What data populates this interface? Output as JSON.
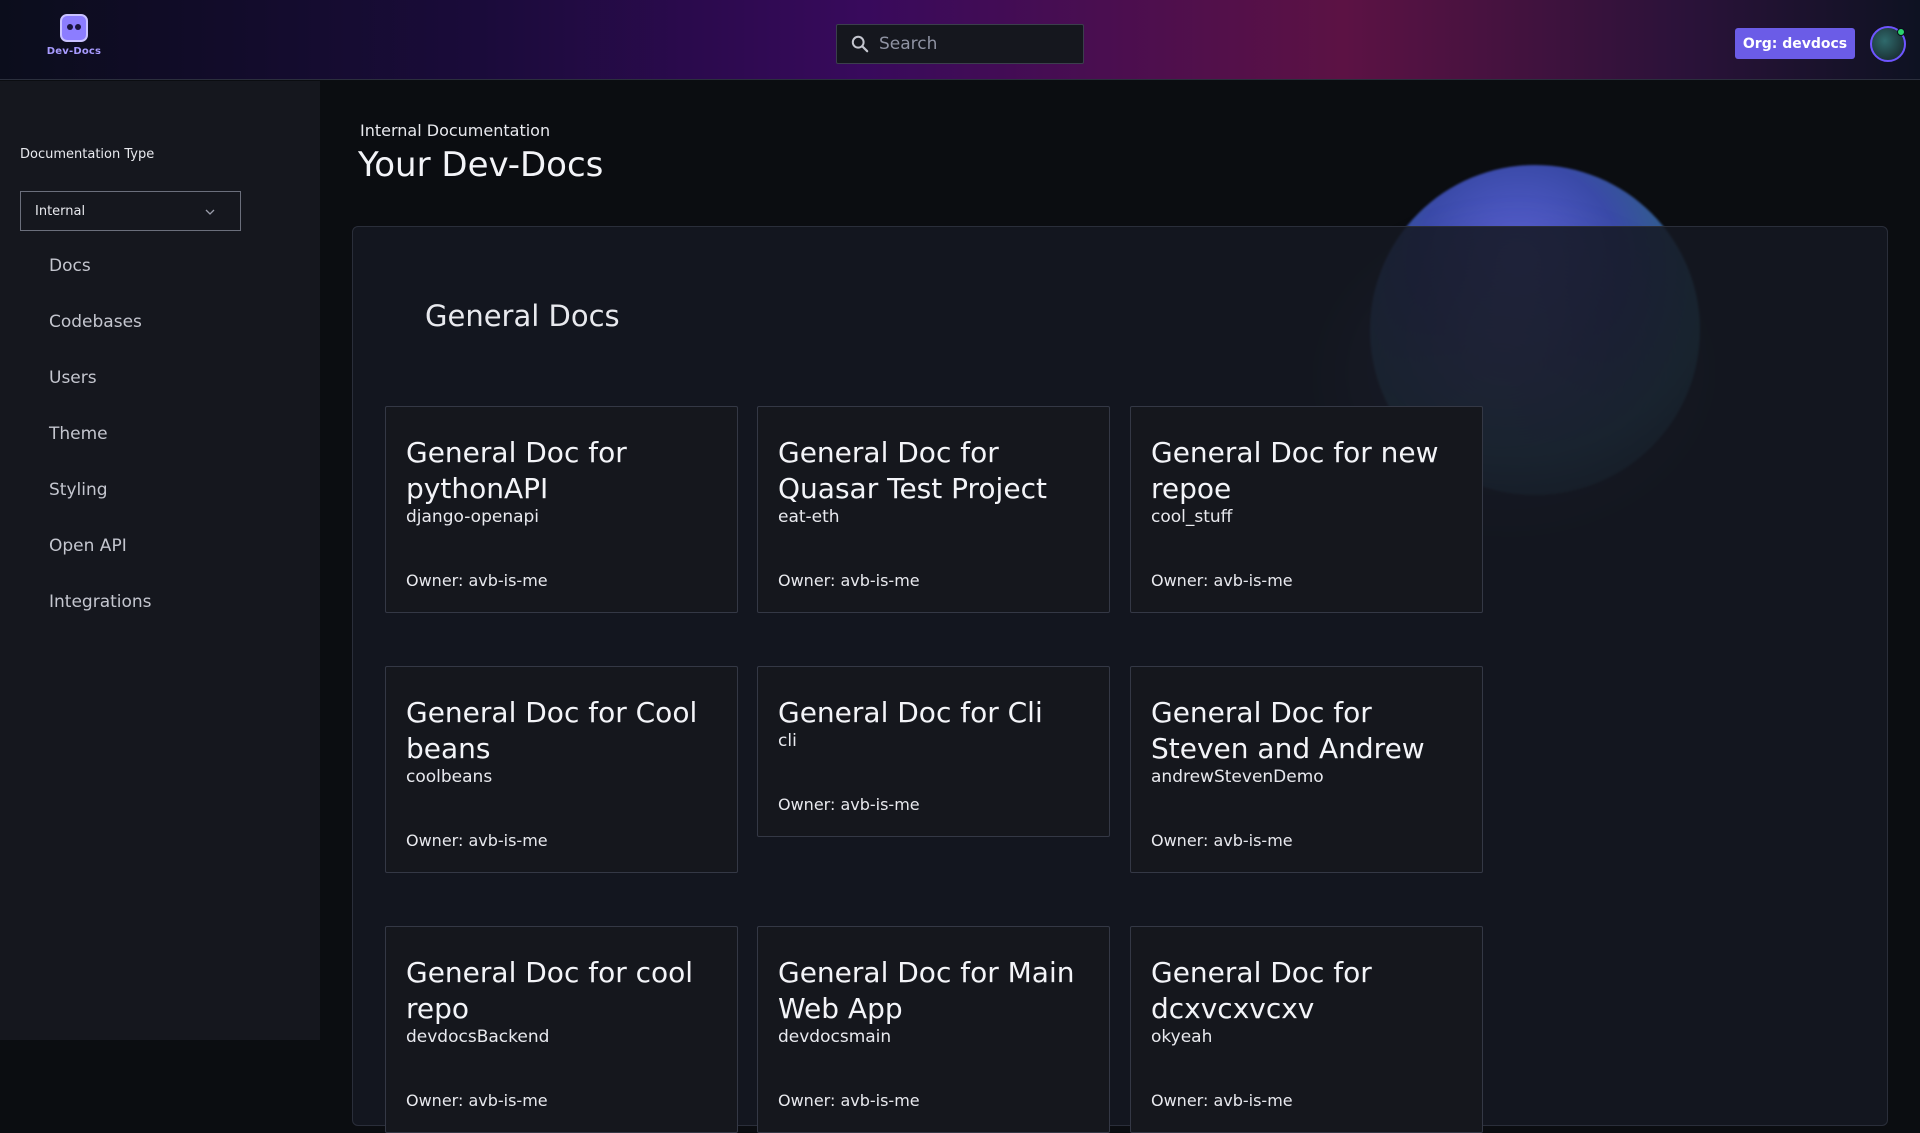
{
  "header": {
    "logo_text": "Dev-Docs",
    "search_placeholder": "Search",
    "org_button": "Org: devdocs"
  },
  "sidebar": {
    "doc_type_label": "Documentation Type",
    "doc_type_selected": "Internal",
    "items": [
      {
        "label": "Docs"
      },
      {
        "label": "Codebases"
      },
      {
        "label": "Users"
      },
      {
        "label": "Theme"
      },
      {
        "label": "Styling"
      },
      {
        "label": "Open API"
      },
      {
        "label": "Integrations"
      }
    ]
  },
  "main": {
    "subtitle": "Internal Documentation",
    "title": "Your Dev-Docs",
    "section_title": "General Docs",
    "cards": [
      {
        "title": "General Doc for pythonAPI",
        "repo": "django-openapi",
        "owner": "Owner: avb-is-me"
      },
      {
        "title": "General Doc for Quasar Test Project",
        "repo": "eat-eth",
        "owner": "Owner: avb-is-me"
      },
      {
        "title": "General Doc for new repoe",
        "repo": "cool_stuff",
        "owner": "Owner: avb-is-me"
      },
      {
        "title": "General Doc for Cool beans",
        "repo": "coolbeans",
        "owner": "Owner: avb-is-me"
      },
      {
        "title": "General Doc for Cli",
        "repo": "cli",
        "owner": "Owner: avb-is-me"
      },
      {
        "title": "General Doc for Steven and Andrew",
        "repo": "andrewStevenDemo",
        "owner": "Owner: avb-is-me"
      },
      {
        "title": "General Doc for cool repo",
        "repo": "devdocsBackend",
        "owner": "Owner: avb-is-me"
      },
      {
        "title": "General Doc for Main Web App",
        "repo": "devdocsmain",
        "owner": "Owner: avb-is-me"
      },
      {
        "title": "General Doc for dcxvcxvcxv",
        "repo": "okyeah",
        "owner": "Owner: avb-is-me"
      }
    ]
  },
  "colors": {
    "accent": "#6b5ce7",
    "background": "#0b0d11",
    "sidebar": "#15171e",
    "card": "#15171d",
    "status_online": "#2bd46f"
  }
}
